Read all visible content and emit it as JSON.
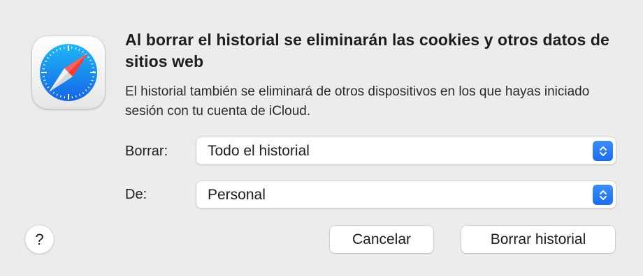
{
  "dialog": {
    "app_icon": "safari-compass-icon",
    "title": "Al borrar el historial se eliminarán las cookies y otros datos de sitios web",
    "message": "El historial también se eliminará de otros dispositivos en los que hayas iniciado sesión con tu cuenta de iCloud.",
    "clear_field": {
      "label": "Borrar:",
      "selected": "Todo el historial"
    },
    "profile_field": {
      "label": "De:",
      "selected": "Personal"
    },
    "buttons": {
      "help": "?",
      "cancel": "Cancelar",
      "confirm": "Borrar historial"
    },
    "colors": {
      "accent": "#1a6ef2",
      "background": "#ececec"
    }
  }
}
